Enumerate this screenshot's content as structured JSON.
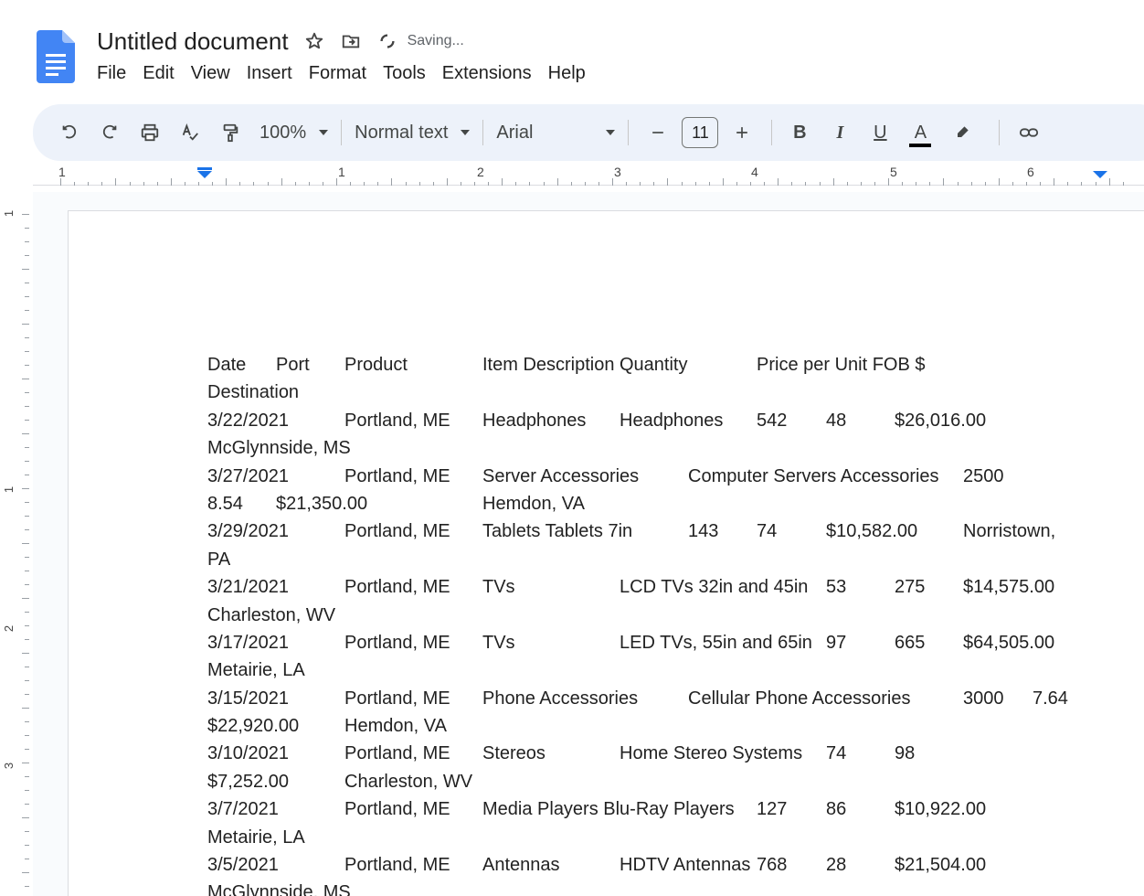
{
  "header": {
    "title": "Untitled document",
    "status": "Saving...",
    "icons": [
      "star-icon",
      "move-to-folder-icon",
      "saving-status-icon"
    ]
  },
  "menu": [
    "File",
    "Edit",
    "View",
    "Insert",
    "Format",
    "Tools",
    "Extensions",
    "Help"
  ],
  "toolbar": {
    "zoom": "100%",
    "style": "Normal text",
    "font": "Arial",
    "font_size": "11",
    "bold": "B",
    "italic": "I",
    "underline": "U",
    "text_color": "A",
    "text_color_value": "#000000"
  },
  "ruler": {
    "top_numbers": [
      "1",
      "1",
      "2",
      "3",
      "4",
      "5",
      "6"
    ],
    "side_numbers": [
      "1",
      "1",
      "2",
      "3"
    ]
  },
  "document": {
    "lines": [
      "Date\tPort\tProduct\tItem Description\tQuantity\tPrice per Unit FOB $",
      "Destination",
      "3/22/2021\tPortland, ME\tHeadphones\tHeadphones\t542\t48\t$26,016.00",
      "McGlynnside, MS",
      "3/27/2021\tPortland, ME\tServer Accessories\tComputer Servers Accessories\t2500",
      "8.54\t$21,350.00\tHemdon, VA",
      "3/29/2021\tPortland, ME\tTablets Tablets 7in\t143\t74\t$10,582.00\tNorristown,",
      "PA",
      "3/21/2021\tPortland, ME\tTVs\tLCD TVs 32in and 45in\t53\t275\t$14,575.00",
      "Charleston, WV",
      "3/17/2021\tPortland, ME\tTVs\tLED TVs, 55in and 65in\t97\t665\t$64,505.00",
      "Metairie, LA",
      "3/15/2021\tPortland, ME\tPhone Accessories\tCellular Phone Accessories\t3000\t7.64",
      "$22,920.00\tHemdon, VA",
      "3/10/2021\tPortland, ME\tStereos\tHome Stereo Systems\t74\t98",
      "$7,252.00\tCharleston, WV",
      "3/7/2021\tPortland, ME\tMedia Players Blu-Ray Players\t127\t86\t$10,922.00",
      "Metairie, LA",
      "3/5/2021\tPortland, ME\tAntennas\tHDTV Antennas\t768\t28\t$21,504.00",
      "McGlynnside, MS"
    ]
  },
  "colors": {
    "toolbar_bg": "#edf2fa",
    "canvas_bg": "#f9fbfd",
    "accent": "#1a73e8",
    "docs_blue": "#4285f4"
  }
}
